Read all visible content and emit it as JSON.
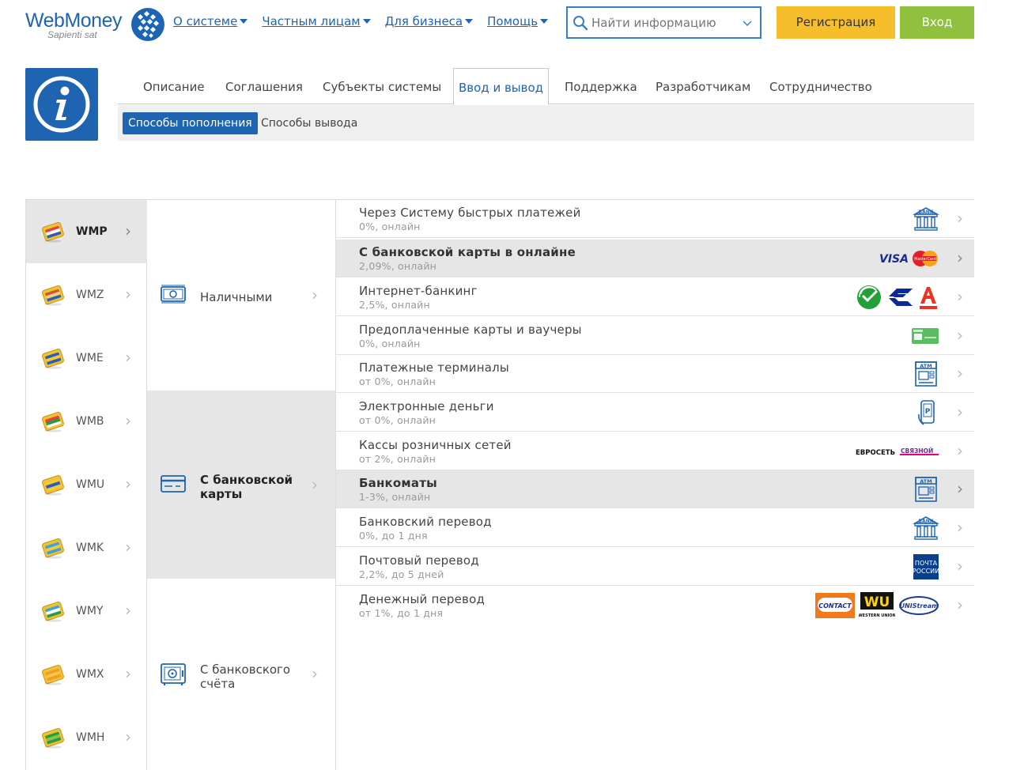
{
  "logo": {
    "name": "WebMoney",
    "tagline": "Sapienti sat"
  },
  "topnav": [
    {
      "label": "О системе"
    },
    {
      "label": "Частным лицам"
    },
    {
      "label": "Для бизнеса"
    },
    {
      "label": "Помощь"
    }
  ],
  "search": {
    "placeholder": "Найти информацию",
    "value": ""
  },
  "auth": {
    "register_label": "Регистрация",
    "login_label": "Вход"
  },
  "colors": {
    "brand_blue": "#1e64b0",
    "register_yellow": "#f5be2a",
    "login_green": "#8fc13e",
    "active_row": "#e6e6e6"
  },
  "tabs": [
    {
      "label": "Описание"
    },
    {
      "label": "Соглашения"
    },
    {
      "label": "Субъекты системы"
    },
    {
      "label": "Ввод и вывод",
      "active": true
    },
    {
      "label": "Поддержка"
    },
    {
      "label": "Разработчикам"
    },
    {
      "label": "Сотрудничество"
    }
  ],
  "subtabs": [
    {
      "label": "Способы пополнения",
      "active": true
    },
    {
      "label": "Способы вывода"
    }
  ],
  "currencies": [
    {
      "label": "WMP",
      "active": true,
      "icon": "wallet-wmp-icon"
    },
    {
      "label": "WMZ",
      "icon": "wallet-wmz-icon"
    },
    {
      "label": "WME",
      "icon": "wallet-wme-icon"
    },
    {
      "label": "WMB",
      "icon": "wallet-wmb-icon"
    },
    {
      "label": "WMU",
      "icon": "wallet-wmu-icon"
    },
    {
      "label": "WMK",
      "icon": "wallet-wmk-icon"
    },
    {
      "label": "WMY",
      "icon": "wallet-wmy-icon"
    },
    {
      "label": "WMX",
      "icon": "wallet-wmx-icon"
    },
    {
      "label": "WMH",
      "icon": "wallet-wmh-icon"
    }
  ],
  "methods": [
    {
      "label": "Наличными",
      "icon": "cash-icon"
    },
    {
      "label": "С банковской карты",
      "active": true,
      "icon": "bank-card-icon"
    },
    {
      "label": "С банковского счёта",
      "icon": "bank-safe-icon"
    }
  ],
  "options": [
    {
      "title": "Через Систему быстрых платежей",
      "sub": "0%, онлайн",
      "logos": [
        "bank-icon"
      ]
    },
    {
      "title": "С банковской карты в онлайне",
      "sub": "2,09%, онлайн",
      "active": true,
      "logos": [
        "visa-logo",
        "mastercard-logo"
      ],
      "visa_text": "VISA",
      "mc_text": "MasterCard"
    },
    {
      "title": "Интернет-банкинг",
      "sub": "2,5%, онлайн",
      "logos": [
        "sberbank-logo",
        "vtb-logo",
        "alfabank-logo"
      ]
    },
    {
      "title": "Предоплаченные карты и ваучеры",
      "sub": "0%, онлайн",
      "logos": [
        "prepaid-card-icon"
      ]
    },
    {
      "title": "Платежные терминалы",
      "sub": "от 0%, онлайн",
      "logos": [
        "atm-icon"
      ]
    },
    {
      "title": "Электронные деньги",
      "sub": "от 0%, онлайн",
      "logos": [
        "phone-payment-icon"
      ]
    },
    {
      "title": "Кассы розничных сетей",
      "sub": "от 2%, онлайн",
      "logos": [
        "euroset-svyaznoy-logo"
      ],
      "euroset_text": "ЕВРОСЕТЬ",
      "svyaznoy_text": "СВЯЗНОЙ"
    },
    {
      "title": "Банкоматы",
      "sub": "1-3%, онлайн",
      "active": true,
      "logos": [
        "atm-icon"
      ]
    },
    {
      "title": "Банковский перевод",
      "sub": "0%, до 1 дня",
      "logos": [
        "bank-icon"
      ]
    },
    {
      "title": "Почтовый перевод",
      "sub": "2,2%, до 5 дней",
      "logos": [
        "russian-post-logo"
      ],
      "post_text_1": "ПОЧТА",
      "post_text_2": "РОССИИ"
    },
    {
      "title": "Денежный перевод",
      "sub": "от 1%, до 1 дня",
      "logos": [
        "contact-logo",
        "western-union-logo",
        "unistream-logo"
      ],
      "contact_text": "CONTACT",
      "wu_text": "WU",
      "wu_sub": "WESTERN UNION",
      "unistream_text": "UNIStream"
    }
  ],
  "icon_texts": {
    "bank": "BANK",
    "atm": "ATM"
  }
}
